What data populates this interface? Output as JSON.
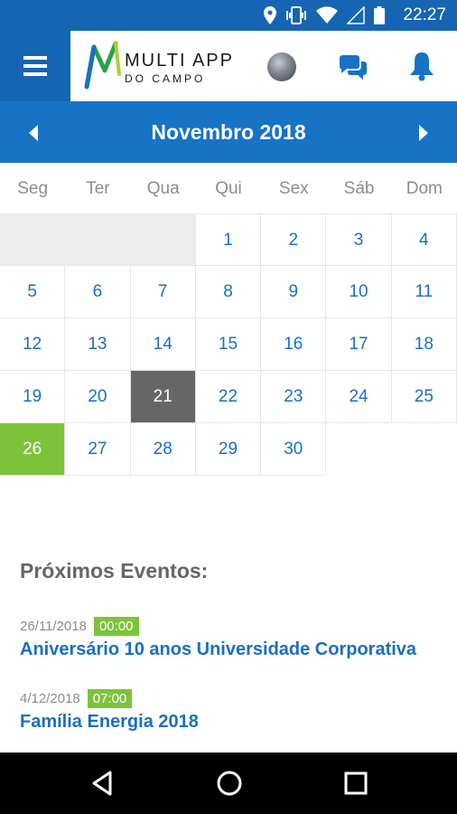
{
  "status_bar": {
    "time": "22:27",
    "icons": [
      "location-icon",
      "vibrate-icon",
      "wifi-icon",
      "signal-icon",
      "battery-icon"
    ]
  },
  "header": {
    "menu_icon": "hamburger-icon",
    "logo_title": "MULTI APP",
    "logo_subtitle": "DO CAMPO",
    "icons": [
      "avatar",
      "chat-icon",
      "bell-icon"
    ]
  },
  "calendar": {
    "month_label": "Novembro 2018",
    "weekdays": [
      "Seg",
      "Ter",
      "Qua",
      "Qui",
      "Sex",
      "Sáb",
      "Dom"
    ],
    "weeks": [
      [
        "",
        "",
        "",
        "1",
        "2",
        "3",
        "4"
      ],
      [
        "5",
        "6",
        "7",
        "8",
        "9",
        "10",
        "11"
      ],
      [
        "12",
        "13",
        "14",
        "15",
        "16",
        "17",
        "18"
      ],
      [
        "19",
        "20",
        "21",
        "22",
        "23",
        "24",
        "25"
      ],
      [
        "26",
        "27",
        "28",
        "29",
        "30",
        "",
        ""
      ]
    ],
    "today": "21",
    "selected": "26",
    "colors": {
      "primary": "#1673c6",
      "today_bg": "#666666",
      "selected_bg": "#7dc33a"
    }
  },
  "events": {
    "title": "Próximos Eventos:",
    "items": [
      {
        "date": "26/11/2018",
        "time": "00:00",
        "name": "Aniversário 10 anos Universidade Corporativa"
      },
      {
        "date": "4/12/2018",
        "time": "07:00",
        "name": "Família Energia 2018"
      }
    ]
  },
  "system_nav": [
    "back-icon",
    "home-icon",
    "recents-icon"
  ]
}
